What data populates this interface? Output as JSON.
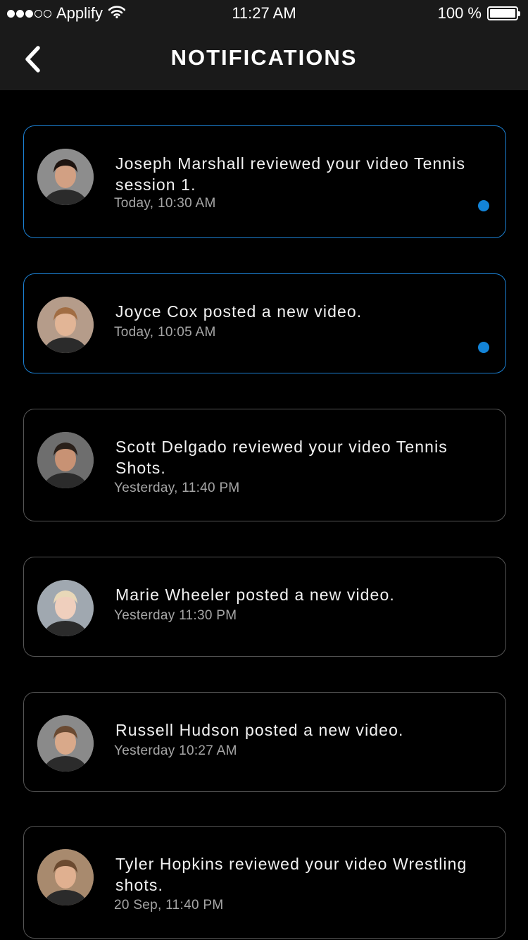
{
  "status_bar": {
    "carrier": "Applify",
    "time": "11:27 AM",
    "battery": "100 %",
    "battery_level": 1.0
  },
  "header": {
    "title": "NOTIFICATIONS"
  },
  "colors": {
    "accent": "#1384d8",
    "unread_border": "#1b7fd1",
    "card_border": "#555555",
    "background": "#000000",
    "header_background": "#1a1a1a"
  },
  "notifications": [
    {
      "message": "Joseph Marshall reviewed your video Tennis session 1.",
      "time": "Today, 10:30 AM",
      "unread": true
    },
    {
      "message": "Joyce Cox posted a new video.",
      "time": "Today, 10:05 AM",
      "unread": true
    },
    {
      "message": "Scott Delgado reviewed your video Tennis Shots.",
      "time": "Yesterday, 11:40 PM",
      "unread": false
    },
    {
      "message": "Marie Wheeler posted a new video.",
      "time": "Yesterday 11:30 PM",
      "unread": false
    },
    {
      "message": "Russell Hudson posted a new video.",
      "time": "Yesterday 10:27 AM",
      "unread": false
    },
    {
      "message": "Tyler Hopkins reviewed your video Wrestling shots.",
      "time": "20 Sep, 11:40 PM",
      "unread": false
    }
  ]
}
